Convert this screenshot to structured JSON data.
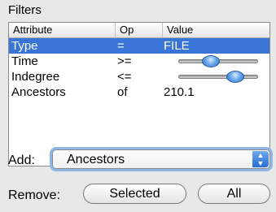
{
  "panel": {
    "title": "Filters"
  },
  "table": {
    "columns": [
      "Attribute",
      "Op",
      "Value"
    ],
    "rows": [
      {
        "attribute": "Type",
        "op": "=",
        "value": "FILE",
        "selected": true
      },
      {
        "attribute": "Time",
        "op": ">=",
        "slider_level": 0.38
      },
      {
        "attribute": "Indegree",
        "op": "<=",
        "slider_level": 0.78
      },
      {
        "attribute": "Ancestors",
        "op": "of",
        "value": "210.1"
      }
    ]
  },
  "add": {
    "label": "Add:",
    "selected_option": "Ancestors"
  },
  "remove": {
    "label": "Remove:",
    "selected_button": "Selected",
    "all_button": "All"
  },
  "colors": {
    "selection": "#3875d7",
    "slider_knob": "#4a8fe0",
    "focus_ring": "#8fb6e8"
  }
}
